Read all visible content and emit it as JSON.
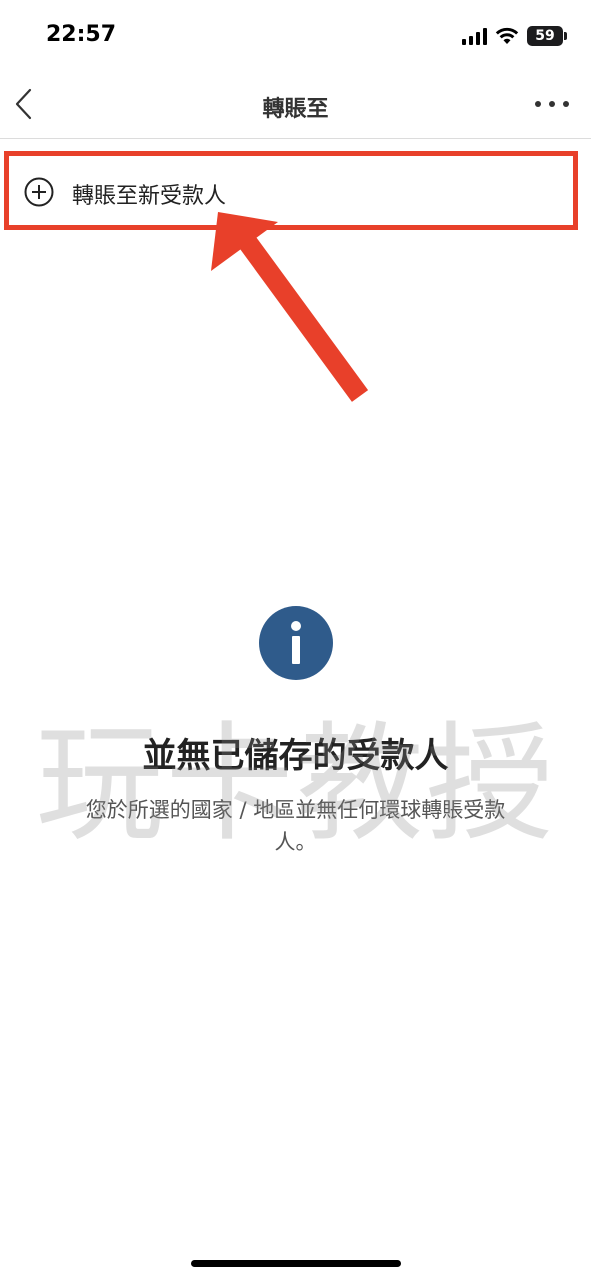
{
  "status_bar": {
    "time": "22:57",
    "battery": "59"
  },
  "header": {
    "title": "轉賬至"
  },
  "new_payee": {
    "label": "轉賬至新受款人"
  },
  "empty_state": {
    "title": "並無已儲存的受款人",
    "description": "您於所選的國家 / 地區並無任何環球轉賬受款人。"
  },
  "watermark": {
    "text": "玩卡教授"
  },
  "colors": {
    "highlight": "#e8402a",
    "info_icon_bg": "#2f5b8b"
  },
  "icons": {
    "back": "chevron-left-icon",
    "more": "more-horizontal-icon",
    "add": "plus-circle-icon",
    "info": "info-icon"
  }
}
